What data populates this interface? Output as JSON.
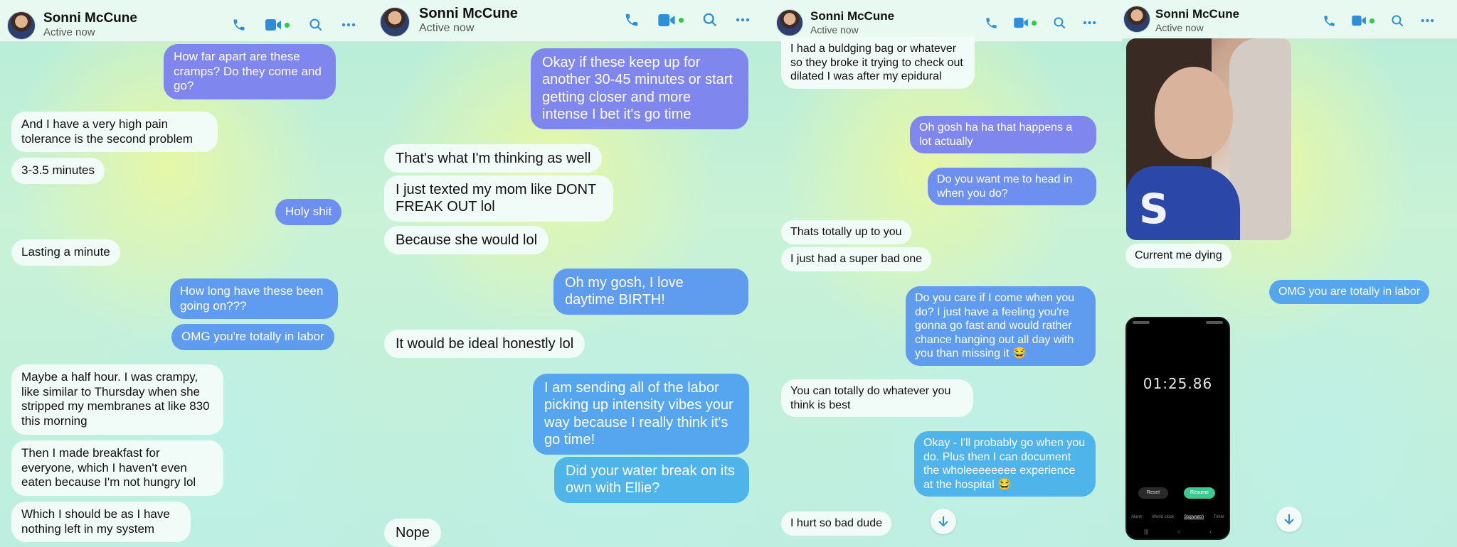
{
  "contact": {
    "name": "Sonni McCune",
    "status": "Active now"
  },
  "icons": {
    "phone": "phone-icon",
    "video": "video-camera-icon",
    "search": "search-icon",
    "more": "more-options-icon",
    "scroll": "scroll-down-icon"
  },
  "colors": {
    "accent": "#2f8fd6",
    "outgoing": "#6c8ff0",
    "incoming": "#f1fbf7",
    "online": "#2ecc40"
  },
  "panel1": {
    "messages": [
      "How far apart are these cramps? Do they come and go?",
      "And I have a very high pain tolerance is the second problem",
      "3-3.5 minutes",
      "Holy shit",
      "Lasting a minute",
      "How long have these been going on???",
      "OMG you're totally in labor",
      "Maybe a half hour. I was crampy, like similar to Thursday when she stripped my membranes at like 830 this morning",
      "Then I made breakfast for everyone, which I haven't even eaten because I'm not hungry lol",
      "Which I should be as I have nothing left in my system"
    ]
  },
  "panel2": {
    "messages": [
      "Okay if these keep up for another 30-45 minutes or start getting closer and more intense I bet it's go time",
      "That's what I'm thinking as well",
      "I just texted my mom like DONT FREAK OUT lol",
      "Because she would lol",
      "Oh my gosh, I love daytime BIRTH!",
      "It would be ideal honestly lol",
      "I am sending all of the labor picking up intensity vibes your way because I really think it's go time!",
      "Did your water break on its own with Ellie?",
      "Nope"
    ]
  },
  "panel3": {
    "messages": [
      "I had a buldging bag or whatever so they broke it trying to check out dilated I was after my epidural",
      "Oh gosh ha ha that happens a lot actually",
      "Do you want me to head in when you do?",
      "Thats totally up to you",
      "I just had a super bad one",
      "Do you care if I come when you do? I just have a feeling you're gonna go fast and would rather chance hanging out all day with you than missing it 😂",
      "You can totally do whatever you think is best",
      "Okay - I'll probably go when you do. Plus then I can document the wholeeeeeeee experience at the hospital 😂",
      "I hurt so bad dude"
    ]
  },
  "panel4": {
    "messages": [
      "Current me dying",
      "OMG you are totally in labor"
    ],
    "photo_shirt_letter": "S",
    "stopwatch": {
      "time": "01:25.86",
      "reset": "Reset",
      "resume": "Resume",
      "tabs": [
        "Alarm",
        "World clock",
        "Stopwatch",
        "Timer"
      ]
    }
  }
}
